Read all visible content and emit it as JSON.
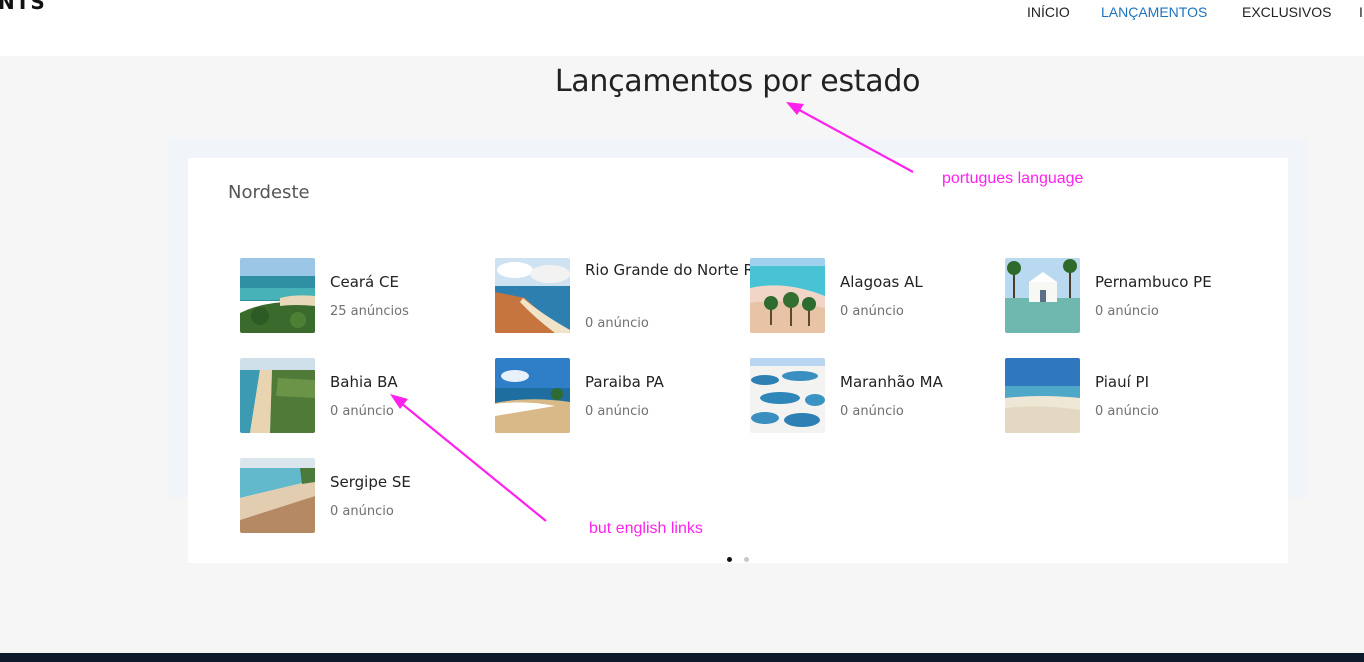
{
  "header": {
    "logo_text": "NTS",
    "nav": [
      {
        "label": "INÍCIO"
      },
      {
        "label": "LANÇAMENTOS"
      },
      {
        "label": "EXCLUSIVOS"
      }
    ]
  },
  "page": {
    "title": "Lançamentos por estado"
  },
  "region": {
    "title": "Nordeste",
    "states": [
      {
        "name": "Ceará CE",
        "count": "25 anúncios"
      },
      {
        "name": "Rio Grande do Norte RN",
        "count": "0 anúncio"
      },
      {
        "name": "Alagoas AL",
        "count": "0 anúncio"
      },
      {
        "name": "Pernambuco PE",
        "count": "0 anúncio"
      },
      {
        "name": "Bahia BA",
        "count": "0 anúncio"
      },
      {
        "name": "Paraiba PA",
        "count": "0 anúncio"
      },
      {
        "name": "Maranhão MA",
        "count": "0 anúncio"
      },
      {
        "name": "Piauí PI",
        "count": "0 anúncio"
      },
      {
        "name": "Sergipe SE",
        "count": "0 anúncio"
      }
    ]
  },
  "carousel": {
    "active_page": 1,
    "pages": 2
  },
  "annotations": {
    "top": "portugues language",
    "bottom": "but english links",
    "color": "#ff22ee"
  },
  "colors": {
    "accent": "#1e73be",
    "footer": "#0c1a2b"
  }
}
